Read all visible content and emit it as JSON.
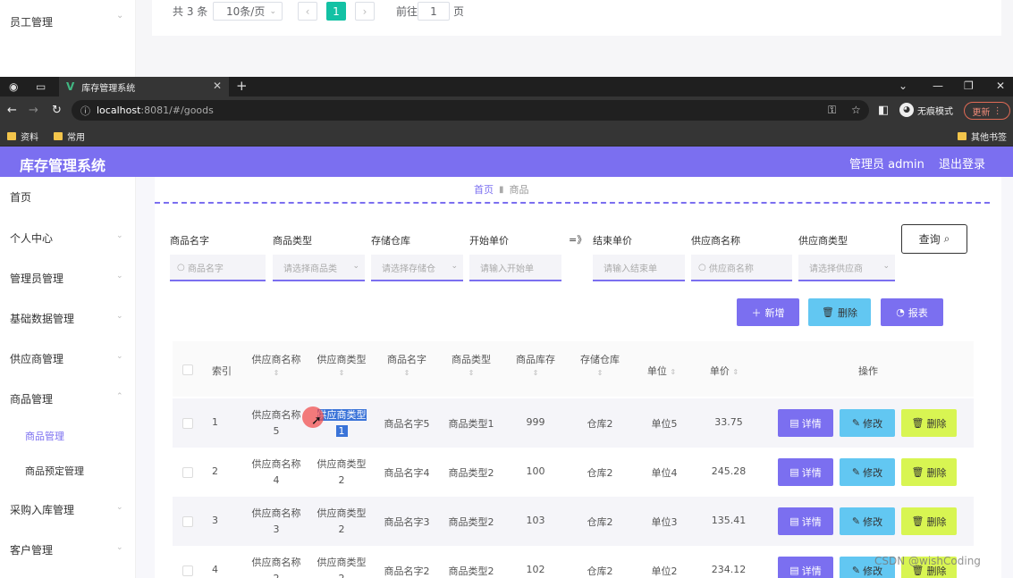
{
  "prev": {
    "sidebar_item": "员工管理",
    "total": "共 3 条",
    "page_size": "10条/页",
    "current_page": "1",
    "goto_label": "前往",
    "goto_value": "1",
    "goto_suffix": "页"
  },
  "browser": {
    "tab_title": "库存管理系统",
    "url_host": "localhost",
    "url_path": ":8081/#/goods",
    "incognito": "无痕模式",
    "update": "更新",
    "bookmarks": [
      "资料",
      "常用"
    ],
    "other_bookmarks": "其他书签"
  },
  "header": {
    "title": "库存管理系统",
    "user": "管理员 admin",
    "logout": "退出登录"
  },
  "sidebar": {
    "items": [
      "首页",
      "个人中心",
      "管理员管理",
      "基础数据管理",
      "供应商管理",
      "商品管理",
      "采购入库管理",
      "客户管理"
    ],
    "sub_items": [
      "商品管理",
      "商品预定管理"
    ]
  },
  "breadcrumb": {
    "home": "首页",
    "current": "商品"
  },
  "filters": {
    "labels": [
      "商品名字",
      "商品类型",
      "存储仓库",
      "开始单价",
      "结束单价",
      "供应商名称",
      "供应商类型"
    ],
    "placeholders": [
      "商品名字",
      "请选择商品类",
      "请选择存储仓",
      "请输入开始单",
      "请输入结束单",
      "供应商名称",
      "请选择供应商"
    ],
    "range_sep": "=》",
    "query": "查询"
  },
  "actions": {
    "add": "新增",
    "delete": "删除",
    "report": "报表"
  },
  "table": {
    "headers": [
      "索引",
      "供应商名称",
      "供应商类型",
      "商品名字",
      "商品类型",
      "商品库存",
      "存储仓库",
      "单位",
      "单价",
      "操作"
    ],
    "rows": [
      {
        "index": "1",
        "supplier_a": "供应商名称",
        "supplier_b": "5",
        "stype_a": "供应商类型",
        "stype_b": "1",
        "name": "商品名字5",
        "type": "商品类型1",
        "stock": "999",
        "warehouse": "仓库2",
        "unit": "单位5",
        "price": "33.75"
      },
      {
        "index": "2",
        "supplier_a": "供应商名称",
        "supplier_b": "4",
        "stype_a": "供应商类型",
        "stype_b": "2",
        "name": "商品名字4",
        "type": "商品类型2",
        "stock": "100",
        "warehouse": "仓库2",
        "unit": "单位4",
        "price": "245.28"
      },
      {
        "index": "3",
        "supplier_a": "供应商名称",
        "supplier_b": "3",
        "stype_a": "供应商类型",
        "stype_b": "2",
        "name": "商品名字3",
        "type": "商品类型2",
        "stock": "103",
        "warehouse": "仓库2",
        "unit": "单位3",
        "price": "135.41"
      },
      {
        "index": "4",
        "supplier_a": "供应商名称",
        "supplier_b": "2",
        "stype_a": "供应商类型",
        "stype_b": "2",
        "name": "商品名字2",
        "type": "商品类型2",
        "stock": "102",
        "warehouse": "仓库2",
        "unit": "单位2",
        "price": "234.12"
      }
    ],
    "row_actions": {
      "detail": "详情",
      "edit": "修改",
      "delete": "删除"
    }
  },
  "watermark": "CSDN @wishCoding",
  "colors": {
    "primary": "#7b6ff0",
    "cyan": "#62c7f2",
    "lime": "#d8f552",
    "pager_active": "#13c1a4"
  }
}
